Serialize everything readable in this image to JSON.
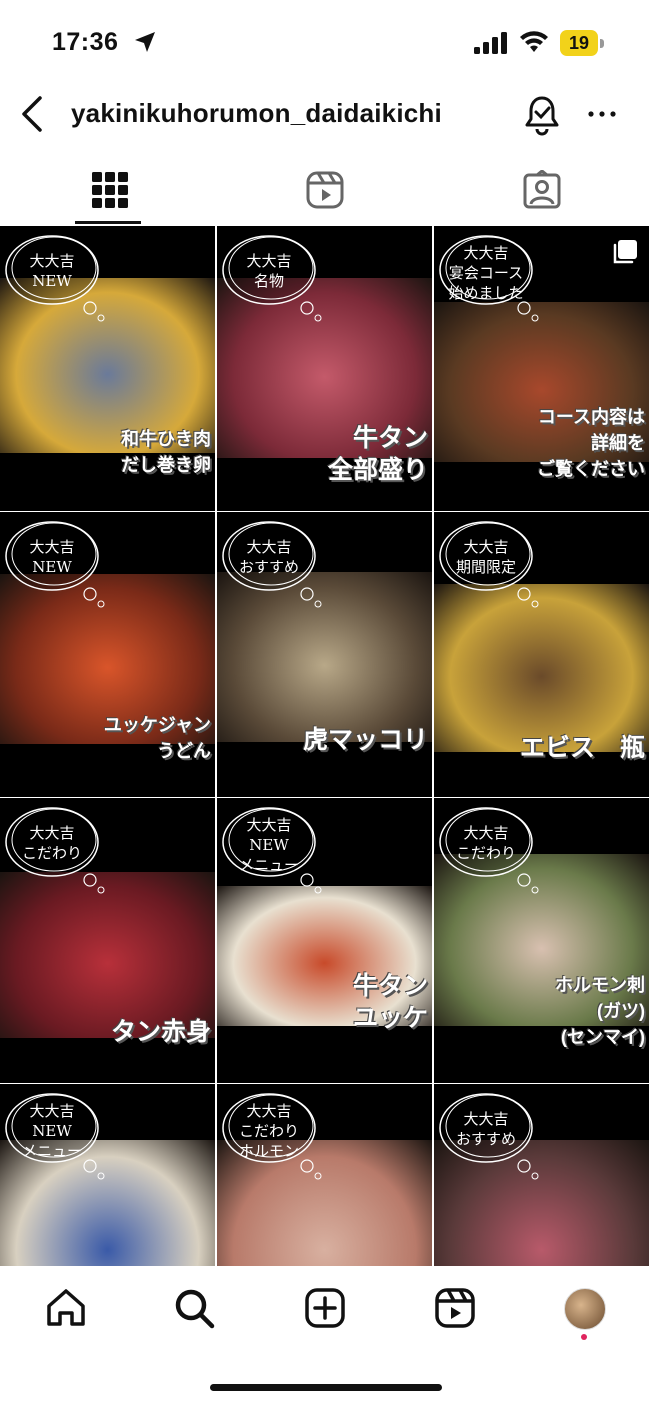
{
  "status_bar": {
    "time": "17:36",
    "battery": "19"
  },
  "header": {
    "username": "yakinikuhorumon_daidaikichi"
  },
  "tabs": [
    {
      "name": "grid",
      "icon": "grid-icon",
      "active": true
    },
    {
      "name": "reels",
      "icon": "reels-icon",
      "active": false
    },
    {
      "name": "tagged",
      "icon": "tagged-icon",
      "active": false
    }
  ],
  "posts": [
    {
      "badge": [
        "大大吉",
        "NEW"
      ],
      "caption": [
        "和牛ひき肉",
        "だし巻き卵"
      ],
      "colors": [
        "#6a7a9a",
        "#d6a93a"
      ]
    },
    {
      "badge": [
        "大大吉",
        "名物"
      ],
      "caption": [
        "牛タン",
        "全部盛り"
      ],
      "colors": [
        "#c45a6a",
        "#7c2a38"
      ]
    },
    {
      "badge": [
        "大大吉",
        "宴会コース",
        "始めました"
      ],
      "caption": [
        "コース内容は",
        "詳細を",
        "ご覧ください"
      ],
      "colors": [
        "#a8482c",
        "#5a3a22"
      ],
      "multi": true
    },
    {
      "badge": [
        "大大吉",
        "NEW"
      ],
      "caption": [
        "ユッケジャン",
        "うどん"
      ],
      "colors": [
        "#d9552a",
        "#7a2a18"
      ]
    },
    {
      "badge": [
        "大大吉",
        "おすすめ"
      ],
      "caption": [
        "虎マッコリ"
      ],
      "colors": [
        "#b8a888",
        "#5a4a38"
      ]
    },
    {
      "badge": [
        "大大吉",
        "期間限定"
      ],
      "caption": [
        "エビス　瓶"
      ],
      "colors": [
        "#6a4a2a",
        "#c8a23a"
      ]
    },
    {
      "badge": [
        "大大吉",
        "こだわり"
      ],
      "caption": [
        "タン赤身"
      ],
      "colors": [
        "#b8303a",
        "#6a1a22"
      ]
    },
    {
      "badge": [
        "大大吉",
        "NEW",
        "メニュー"
      ],
      "caption": [
        "牛タン",
        "ユッケ"
      ],
      "colors": [
        "#c84a2a",
        "#e8e0d0"
      ]
    },
    {
      "badge": [
        "大大吉",
        "こだわり"
      ],
      "caption": [
        "ホルモン刺",
        "(ガツ)",
        "(センマイ)"
      ],
      "colors": [
        "#d8c0b0",
        "#6a7a4a"
      ]
    },
    {
      "badge": [
        "大大吉",
        "NEW",
        "メニュー"
      ],
      "caption": [],
      "colors": [
        "#3a5aa8",
        "#d8d0c0"
      ]
    },
    {
      "badge": [
        "大大吉",
        "こだわり",
        "ホルモン"
      ],
      "caption": [],
      "colors": [
        "#d8b0a0",
        "#b87a6a"
      ]
    },
    {
      "badge": [
        "大大吉",
        "おすすめ"
      ],
      "caption": [],
      "colors": [
        "#b85a6a",
        "#5a3a3a"
      ]
    }
  ],
  "bottom_nav": [
    {
      "name": "home",
      "icon": "home-icon"
    },
    {
      "name": "search",
      "icon": "search-icon"
    },
    {
      "name": "create",
      "icon": "plus-square-icon"
    },
    {
      "name": "reels",
      "icon": "reels-icon"
    },
    {
      "name": "profile",
      "icon": "profile-avatar"
    }
  ]
}
